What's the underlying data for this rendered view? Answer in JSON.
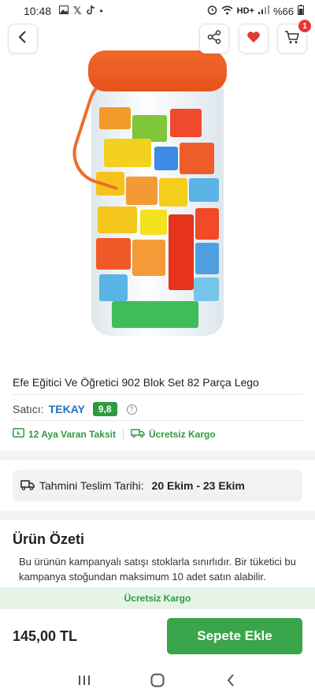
{
  "status_bar": {
    "time": "10:48",
    "network": "HD+",
    "battery": "%66"
  },
  "header": {
    "cart_count": "1"
  },
  "product": {
    "title": "Efe Eğitici Ve Öğretici 902 Blok Set 82 Parça Lego",
    "seller_label": "Satıcı:",
    "seller_name": "TEKAY",
    "seller_rating": "9,8",
    "features": [
      {
        "label": "12 Aya Varan Taksit"
      },
      {
        "label": "Ücretsiz Kargo"
      }
    ]
  },
  "delivery": {
    "label": "Tahmini Teslim Tarihi:",
    "value": "20 Ekim - 23 Ekim"
  },
  "summary": {
    "title": "Ürün Özeti",
    "text": "Bu ürünün kampanyalı satışı stoklarla sınırlıdır. Bir tüketici bu kampanya stoğundan maksimum 10 adet satın alabilir. Çiçeksepeti kampanya koşullarında değişiklik yapma hakkını"
  },
  "banner": {
    "free_cargo": "Ücretsiz Kargo"
  },
  "purchase": {
    "price": "145,00 TL",
    "add_to_cart_label": "Sepete Ekle"
  },
  "colors": {
    "accent_green": "#3aa54a",
    "seller_blue": "#1a73c8",
    "favorite_red": "#e53935"
  }
}
